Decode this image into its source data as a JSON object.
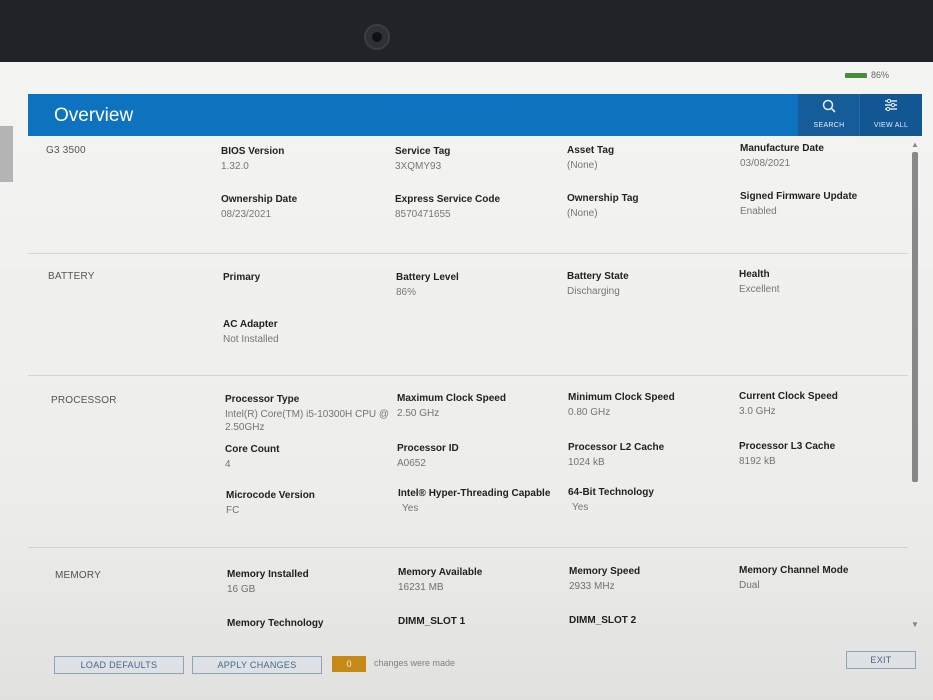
{
  "status": {
    "battery_percent_text": "86%"
  },
  "header": {
    "title": "Overview",
    "search_label": "SEARCH",
    "viewall_label": "VIEW ALL"
  },
  "sections": {
    "system": {
      "label": "G3 3500",
      "fields": [
        {
          "key": "BIOS Version",
          "value": "1.32.0"
        },
        {
          "key": "Service Tag",
          "value": "3XQMY93"
        },
        {
          "key": "Asset Tag",
          "value": "(None)"
        },
        {
          "key": "Manufacture Date",
          "value": "03/08/2021"
        },
        {
          "key": "Ownership Date",
          "value": "08/23/2021"
        },
        {
          "key": "Express Service Code",
          "value": "8570471655"
        },
        {
          "key": "Ownership Tag",
          "value": "(None)"
        },
        {
          "key": "Signed Firmware Update",
          "value": "Enabled"
        }
      ]
    },
    "battery": {
      "label": "BATTERY",
      "fields": [
        {
          "key": "Primary",
          "value": ""
        },
        {
          "key": "Battery Level",
          "value": "86%"
        },
        {
          "key": "Battery State",
          "value": "Discharging"
        },
        {
          "key": "Health",
          "value": "Excellent"
        },
        {
          "key": "AC Adapter",
          "value": "Not Installed"
        }
      ]
    },
    "processor": {
      "label": "PROCESSOR",
      "fields": [
        {
          "key": "Processor Type",
          "value": "Intel(R) Core(TM) i5-10300H CPU @ 2.50GHz"
        },
        {
          "key": "Maximum Clock Speed",
          "value": "2.50 GHz"
        },
        {
          "key": "Minimum Clock Speed",
          "value": "0.80 GHz"
        },
        {
          "key": "Current Clock Speed",
          "value": "3.0 GHz"
        },
        {
          "key": "Core Count",
          "value": "4"
        },
        {
          "key": "Processor ID",
          "value": "A0652"
        },
        {
          "key": "Processor L2 Cache",
          "value": "1024 kB"
        },
        {
          "key": "Processor L3 Cache",
          "value": "8192 kB"
        },
        {
          "key": "Microcode Version",
          "value": "FC"
        },
        {
          "key": "Intel® Hyper-Threading Capable",
          "value": "Yes"
        },
        {
          "key": "64-Bit Technology",
          "value": "Yes"
        }
      ]
    },
    "memory": {
      "label": "MEMORY",
      "fields": [
        {
          "key": "Memory Installed",
          "value": "16 GB"
        },
        {
          "key": "Memory Available",
          "value": "16231 MB"
        },
        {
          "key": "Memory Speed",
          "value": "2933 MHz"
        },
        {
          "key": "Memory Channel Mode",
          "value": "Dual"
        },
        {
          "key": "Memory Technology",
          "value": ""
        },
        {
          "key": "DIMM_SLOT 1",
          "value": ""
        },
        {
          "key": "DIMM_SLOT 2",
          "value": ""
        }
      ]
    }
  },
  "footer": {
    "load_defaults": "LOAD DEFAULTS",
    "apply_changes": "APPLY CHANGES",
    "changes_count": "0",
    "changes_text": "changes were made",
    "exit": "EXIT"
  },
  "colors": {
    "header_blue": "#0d73c0",
    "badge_orange": "#d59417",
    "battery_green": "#4a8c3a"
  },
  "icons": [
    "search-icon",
    "view-all-icon",
    "battery-icon"
  ]
}
